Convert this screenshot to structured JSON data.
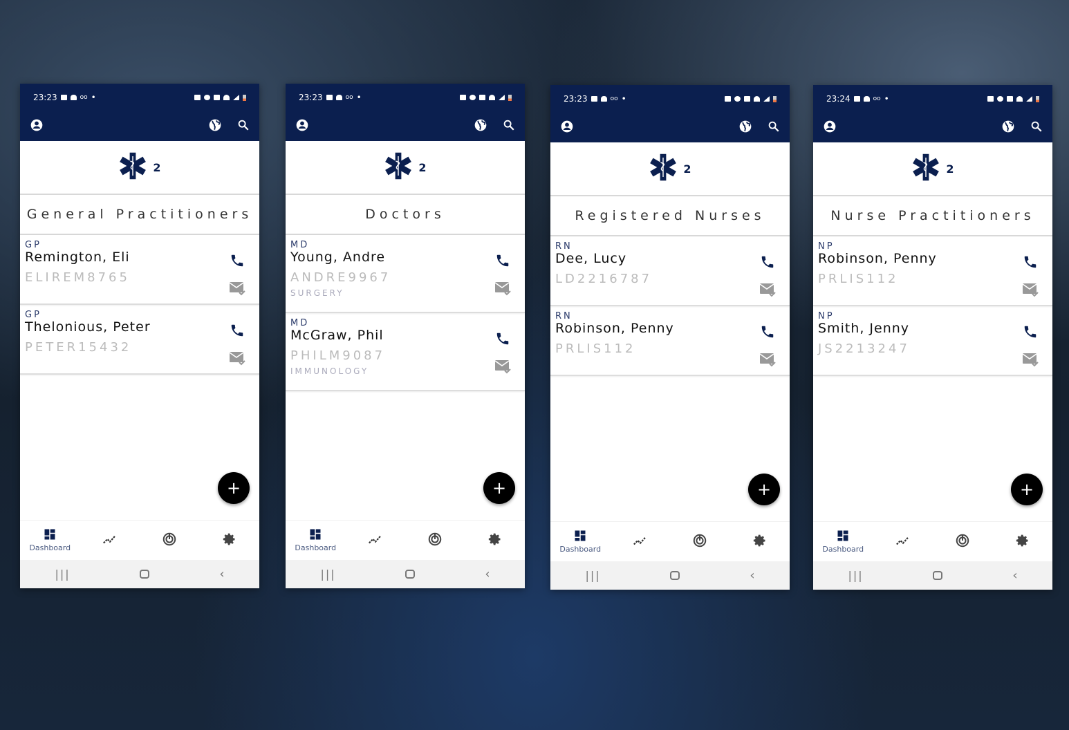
{
  "colors": {
    "navy": "#0b1f4f",
    "fab": "#000000"
  },
  "nav": {
    "dashboard_label": "Dashboard"
  },
  "phones": [
    {
      "time": "23:23",
      "count": "2",
      "title": "General Practitioners",
      "contacts": [
        {
          "role": "GP",
          "name": "Remington, Eli",
          "id": "ELIREM8765"
        },
        {
          "role": "GP",
          "name": "Thelonious, Peter",
          "id": "PETER15432"
        }
      ]
    },
    {
      "time": "23:23",
      "count": "2",
      "title": "Doctors",
      "contacts": [
        {
          "role": "MD",
          "name": "Young, Andre",
          "id": "ANDRE9967",
          "specialty": "SURGERY"
        },
        {
          "role": "MD",
          "name": "McGraw, Phil",
          "id": "PHILM9087",
          "specialty": "IMMUNOLOGY"
        }
      ]
    },
    {
      "time": "23:23",
      "count": "2",
      "title": "Registered Nurses",
      "contacts": [
        {
          "role": "RN",
          "name": "Dee, Lucy",
          "id": "LD2216787"
        },
        {
          "role": "RN",
          "name": "Robinson, Penny",
          "id": "PRLIS112"
        }
      ]
    },
    {
      "time": "23:24",
      "count": "2",
      "title": "Nurse Practitioners",
      "contacts": [
        {
          "role": "NP",
          "name": "Robinson, Penny",
          "id": "PRLIS112"
        },
        {
          "role": "NP",
          "name": "Smith, Jenny",
          "id": "JS2213247"
        }
      ]
    }
  ]
}
